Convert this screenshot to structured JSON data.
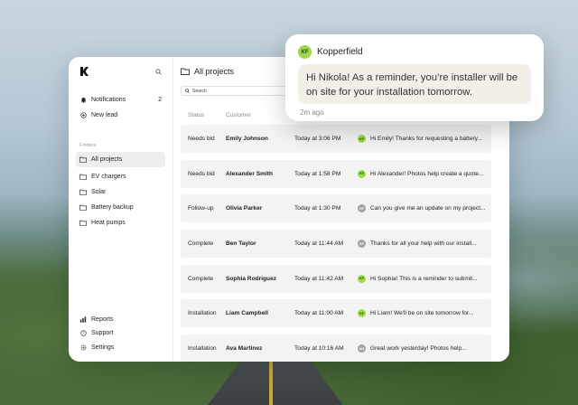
{
  "sidebar": {
    "notifications_label": "Notifications",
    "notifications_count": "2",
    "new_lead_label": "New lead",
    "folders_label": "Folders",
    "folders": [
      {
        "label": "All projects"
      },
      {
        "label": "EV chargers"
      },
      {
        "label": "Solar"
      },
      {
        "label": "Battery backup"
      },
      {
        "label": "Heat pumps"
      }
    ],
    "bottom": [
      {
        "label": "Reports"
      },
      {
        "label": "Support"
      },
      {
        "label": "Settings"
      }
    ]
  },
  "main": {
    "title": "All projects",
    "search_placeholder": "Search",
    "columns": {
      "status": "Status",
      "customer": "Customer"
    },
    "rows": [
      {
        "status": "Needs bid",
        "name": "Emily Johnson",
        "time": "Today at 3:06 PM",
        "badge": "KF",
        "message": "Hi Emily! Thanks for requesting a battery..."
      },
      {
        "status": "Needs bid",
        "name": "Alexander Smith",
        "time": "Today at 1:58 PM",
        "badge": "KF",
        "message": "Hi Alexander! Photos help create a quote..."
      },
      {
        "status": "Follow-up",
        "name": "Olivia Parker",
        "time": "Today at 1:30 PM",
        "badge": "OP",
        "message": "Can you give me an update on my project..."
      },
      {
        "status": "Complete",
        "name": "Ben Taylor",
        "time": "Today at 11:44 AM",
        "badge": "BT",
        "message": "Thanks for all your help with our install..."
      },
      {
        "status": "Complete",
        "name": "Sophia Rodriguez",
        "time": "Today at 11:42 AM",
        "badge": "KF",
        "message": "Hi Sophia! This is a reminder to submit..."
      },
      {
        "status": "Installation",
        "name": "Liam Campbell",
        "time": "Today at 11:00 AM",
        "badge": "KF",
        "message": "Hi Liam! We'll be on site tomorrow for..."
      },
      {
        "status": "Installation",
        "name": "Ava Martinez",
        "time": "Today at 10:16 AM",
        "badge": "AM",
        "message": "Great work yesterday! Photos help..."
      }
    ]
  },
  "toast": {
    "badge": "KF",
    "sender": "Kopperfield",
    "message": "Hi Nikola! As a reminder, you’re installer will be on site for your installation tomorrow.",
    "time": "2m ago"
  },
  "colors": {
    "accent": "#9bd84a"
  }
}
